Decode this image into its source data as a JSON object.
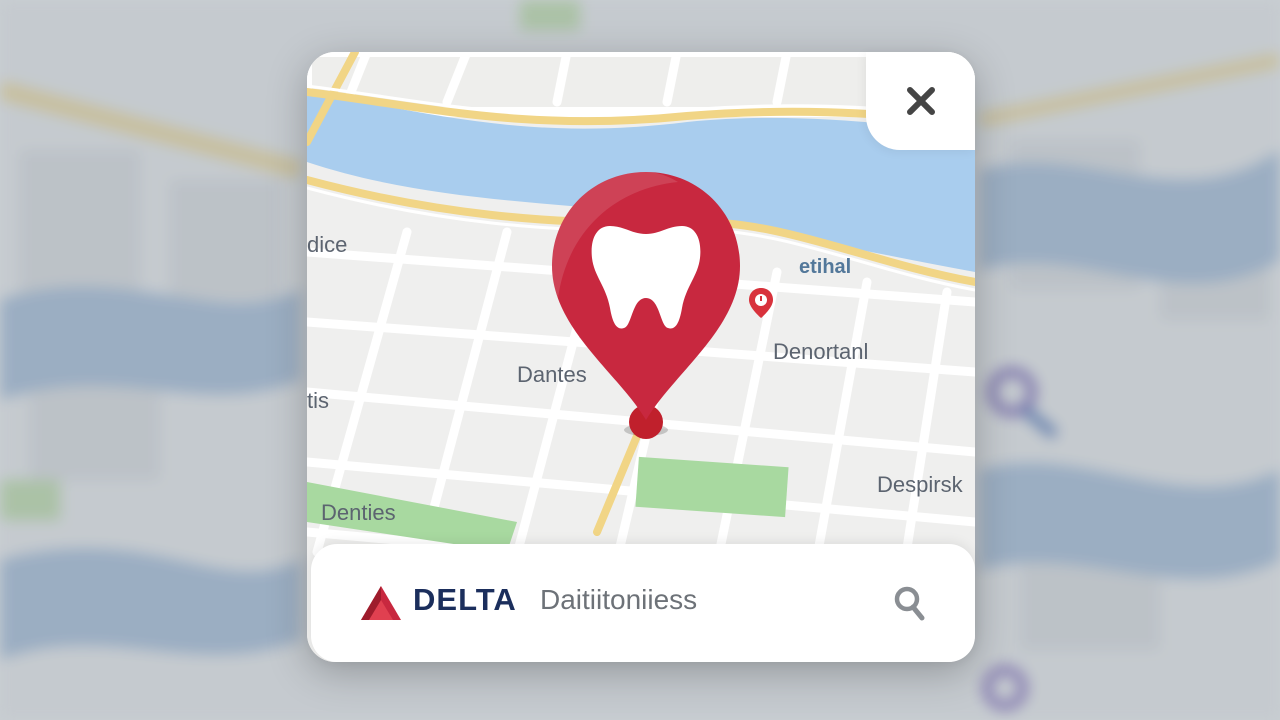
{
  "background": {
    "description_hidden": ""
  },
  "map": {
    "labels": {
      "top_left": "dice",
      "top_right": "etihal",
      "center": "Dantes",
      "right": "Denortanl",
      "left": "tis",
      "bottom_left": "Denties",
      "bottom_right": "Despirsk"
    },
    "colors": {
      "water": "#a9cdee",
      "road_major": "#f3d98a",
      "road_minor": "#ffffff",
      "block": "#ececec",
      "park": "#a8d9a0",
      "pin": "#c8283f"
    }
  },
  "pin": {
    "icon": "tooth-icon",
    "color": "#c8283f"
  },
  "close_button": {
    "icon": "close-icon"
  },
  "search_bar": {
    "brand_name": "DELTA",
    "text": "Daitiitoniiess",
    "icon": "search-icon",
    "brand_color": "#1b2e5c",
    "logo_color": "#c8283f"
  }
}
